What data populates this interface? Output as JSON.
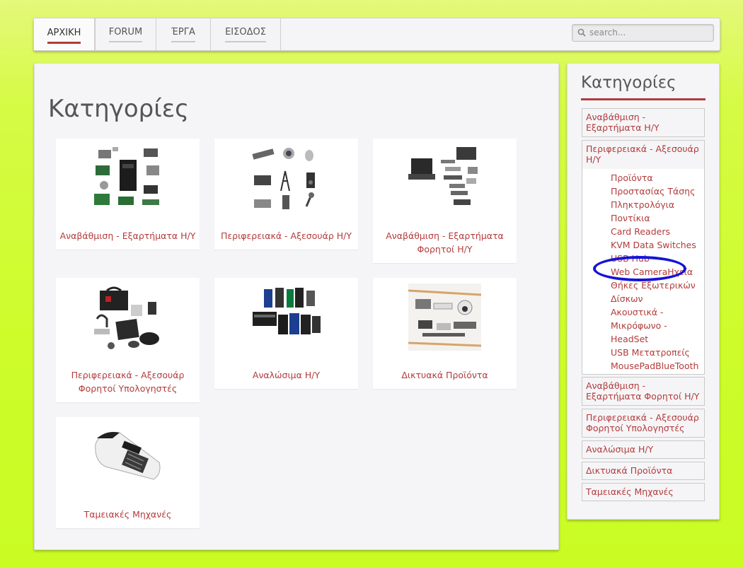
{
  "nav": {
    "items": [
      {
        "label": "ΑΡΧΙΚΗ",
        "active": true
      },
      {
        "label": "FORUM",
        "active": false
      },
      {
        "label": "ΈΡΓΑ",
        "active": false
      },
      {
        "label": "ΕΙΣΟΔΟΣ",
        "active": false
      }
    ],
    "search": {
      "placeholder": "search..."
    }
  },
  "main": {
    "title": "Κατηγορίες",
    "cards": [
      {
        "label": "Αναβάθμιση - Εξαρτήματα Η/Υ",
        "icon": "pc-components-image"
      },
      {
        "label": "Περιφερειακά - Αξεσουάρ Η/Υ",
        "icon": "peripherals-image"
      },
      {
        "label": "Αναβάθμιση - Εξαρτήματα Φορητοί Η/Υ",
        "icon": "laptop-parts-image"
      },
      {
        "label": "Περιφερειακά - Αξεσουάρ Φορητοί Υπολογηστές",
        "icon": "laptop-accessories-image"
      },
      {
        "label": "Αναλώσιμα Η/Υ",
        "icon": "printer-supplies-image"
      },
      {
        "label": "Δικτυακά Προϊόντα",
        "icon": "network-products-image"
      },
      {
        "label": "Ταμειακές Μηχανές",
        "icon": "cash-register-image"
      }
    ]
  },
  "sidebar": {
    "title": "Κατηγορίες",
    "categories": [
      {
        "label": "Αναβάθμιση - Εξαρτήματα Η/Υ"
      },
      {
        "label": "Περιφερειακά - Αξεσουάρ Η/Υ",
        "subitems": [
          "Προϊόντα",
          "Προστασίας Τάσης",
          "Πληκτρολόγια",
          "Ποντίκια",
          "Card Readers",
          "KVM Data Switches",
          "USB Hub",
          "Web CameraΗχεία",
          "Θήκες Εξωτερικών",
          "Δίσκων",
          "Ακουστικά -",
          "Μικρόφωνο -",
          "HeadSet",
          "USB Μετατροπείς",
          "MousePadBlueTooth"
        ]
      },
      {
        "label": "Αναβάθμιση - Εξαρτήματα Φορητοί Η/Υ"
      },
      {
        "label": "Περιφερειακά - Αξεσουάρ Φορητοί Υπολογηστές"
      },
      {
        "label": "Αναλώσιμα Η/Υ"
      },
      {
        "label": "Δικτυακά Προϊόντα"
      },
      {
        "label": "Ταμειακές Μηχανές"
      }
    ]
  },
  "colors": {
    "accent": "#b33b3b",
    "background": "#cdfc2a",
    "highlight_oval": "#1414d8"
  }
}
